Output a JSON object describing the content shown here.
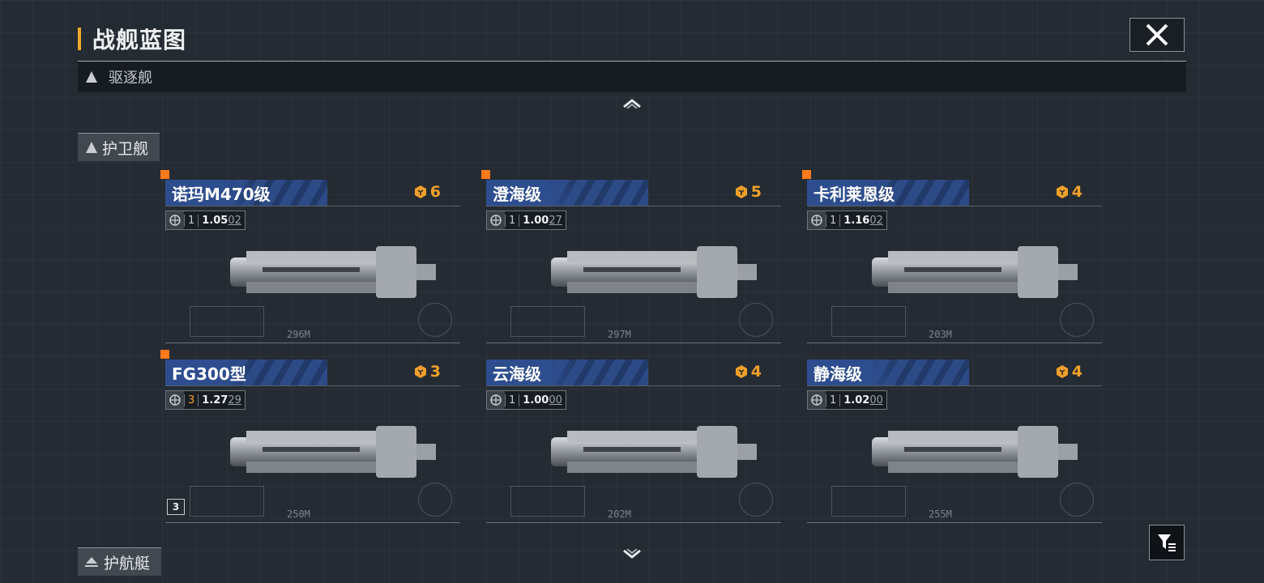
{
  "header": {
    "title": "战舰蓝图"
  },
  "categories": {
    "destroyer": "驱逐舰",
    "frigate": "护卫舰",
    "corvette": "护航艇"
  },
  "ships": [
    {
      "name": "诺玛M470级",
      "cost": "6",
      "tier": "1",
      "ver_main": "1.05",
      "ver_sub": "02",
      "length": "296M",
      "has_marker": true,
      "tier_gold": false
    },
    {
      "name": "澄海级",
      "cost": "5",
      "tier": "1",
      "ver_main": "1.00",
      "ver_sub": "27",
      "length": "297M",
      "has_marker": true,
      "tier_gold": false
    },
    {
      "name": "卡利莱恩级",
      "cost": "4",
      "tier": "1",
      "ver_main": "1.16",
      "ver_sub": "02",
      "length": "203M",
      "has_marker": true,
      "tier_gold": false
    },
    {
      "name": "FG300型",
      "cost": "3",
      "tier": "3",
      "ver_main": "1.27",
      "ver_sub": "29",
      "length": "250M",
      "has_marker": true,
      "tier_gold": true
    },
    {
      "name": "云海级",
      "cost": "4",
      "tier": "1",
      "ver_main": "1.00",
      "ver_sub": "00",
      "length": "202M",
      "has_marker": false,
      "tier_gold": false
    },
    {
      "name": "静海级",
      "cost": "4",
      "tier": "1",
      "ver_main": "1.02",
      "ver_sub": "00",
      "length": "255M",
      "has_marker": false,
      "tier_gold": false
    }
  ],
  "size_badge": "3",
  "colors": {
    "accent": "#f3a62b",
    "cost": "#f0a02a",
    "marker": "#ff7a1a",
    "band": "#2c4a86"
  }
}
